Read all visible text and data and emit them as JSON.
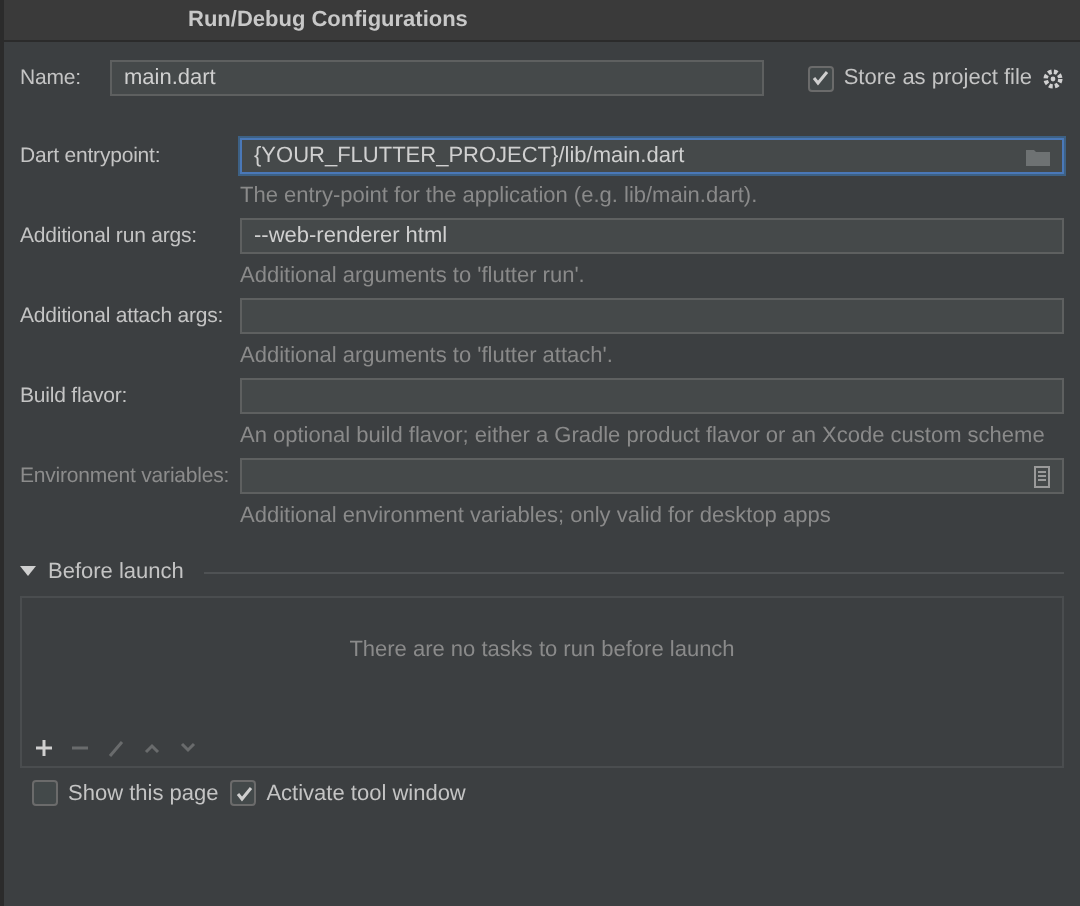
{
  "window": {
    "title": "Run/Debug Configurations"
  },
  "name_field": {
    "label": "Name:",
    "value": "main.dart"
  },
  "store_as_project_file": {
    "label": "Store as project file",
    "checked": true
  },
  "fields": [
    {
      "kind": "browse",
      "label": "Dart entrypoint:",
      "value": "{YOUR_FLUTTER_PROJECT}/lib/main.dart",
      "hint": "The entry-point for the application (e.g. lib/main.dart).",
      "focused": true,
      "disabled": false
    },
    {
      "kind": "text",
      "label": "Additional run args:",
      "value": "--web-renderer html",
      "hint": "Additional arguments to 'flutter run'.",
      "focused": false,
      "disabled": false
    },
    {
      "kind": "text",
      "label": "Additional attach args:",
      "hint": "Additional arguments to 'flutter attach'.",
      "focused": false,
      "disabled": false
    },
    {
      "kind": "text",
      "label": "Build flavor:",
      "hint": "An optional build flavor; either a Gradle product flavor or an Xcode custom scheme",
      "focused": false,
      "disabled": false
    },
    {
      "kind": "env",
      "label": "Environment variables:",
      "hint": "Additional environment variables; only valid for desktop apps",
      "focused": false,
      "disabled": true
    }
  ],
  "before_launch": {
    "title": "Before launch",
    "expanded": true,
    "empty_text": "There are no tasks to run before launch",
    "toolbar": [
      {
        "kind": "add",
        "disabled": false
      },
      {
        "kind": "remove",
        "disabled": true
      },
      {
        "kind": "edit",
        "disabled": true
      },
      {
        "kind": "up",
        "disabled": true
      },
      {
        "kind": "down",
        "disabled": true
      }
    ]
  },
  "options": [
    {
      "label": "Show this page",
      "checked": false
    },
    {
      "label": "Activate tool window",
      "checked": true
    }
  ]
}
